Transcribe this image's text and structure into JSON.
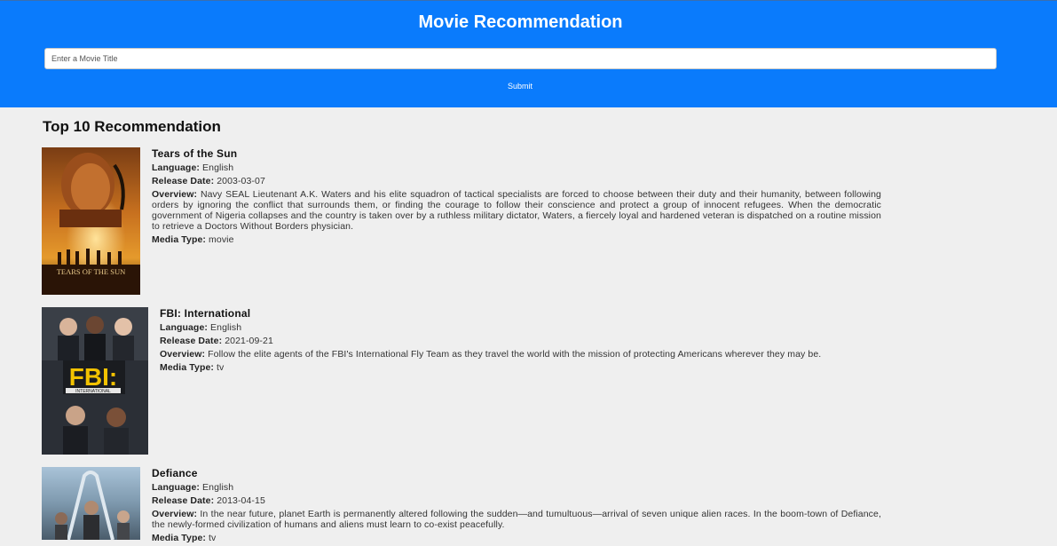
{
  "header": {
    "title": "Movie Recommendation",
    "search": {
      "placeholder": "Enter a Movie Title",
      "value": ""
    },
    "submit_label": "Submit"
  },
  "results": {
    "heading": "Top 10 Recommendation",
    "field_labels": {
      "language": "Language:",
      "release_date": "Release Date:",
      "overview": "Overview:",
      "media_type": "Media Type:"
    },
    "items": [
      {
        "title": "Tears of the Sun",
        "language": "English",
        "release_date": "2003-03-07",
        "overview": "Navy SEAL Lieutenant A.K. Waters and his elite squadron of tactical specialists are forced to choose between their duty and their humanity, between following orders by ignoring the conflict that surrounds them, or finding the courage to follow their conscience and protect a group of innocent refugees. When the democratic government of Nigeria collapses and the country is taken over by a ruthless military dictator, Waters, a fiercely loyal and hardened veteran is dispatched on a routine mission to retrieve a Doctors Without Borders physician.",
        "media_type": "movie",
        "poster_text": "TEARS OF THE SUN"
      },
      {
        "title": "FBI: International",
        "language": "English",
        "release_date": "2021-09-21",
        "overview": "Follow the elite agents of the FBI's International Fly Team as they travel the world with the mission of protecting Americans wherever they may be.",
        "media_type": "tv",
        "poster_text": "FBI:",
        "poster_subtext": "INTERNATIONAL"
      },
      {
        "title": "Defiance",
        "language": "English",
        "release_date": "2013-04-15",
        "overview": "In the near future, planet Earth is permanently altered following the sudden—and tumultuous—arrival of seven unique alien races. In the boom-town of Defiance, the newly-formed civilization of humans and aliens must learn to co-exist peacefully.",
        "media_type": "tv"
      }
    ]
  }
}
